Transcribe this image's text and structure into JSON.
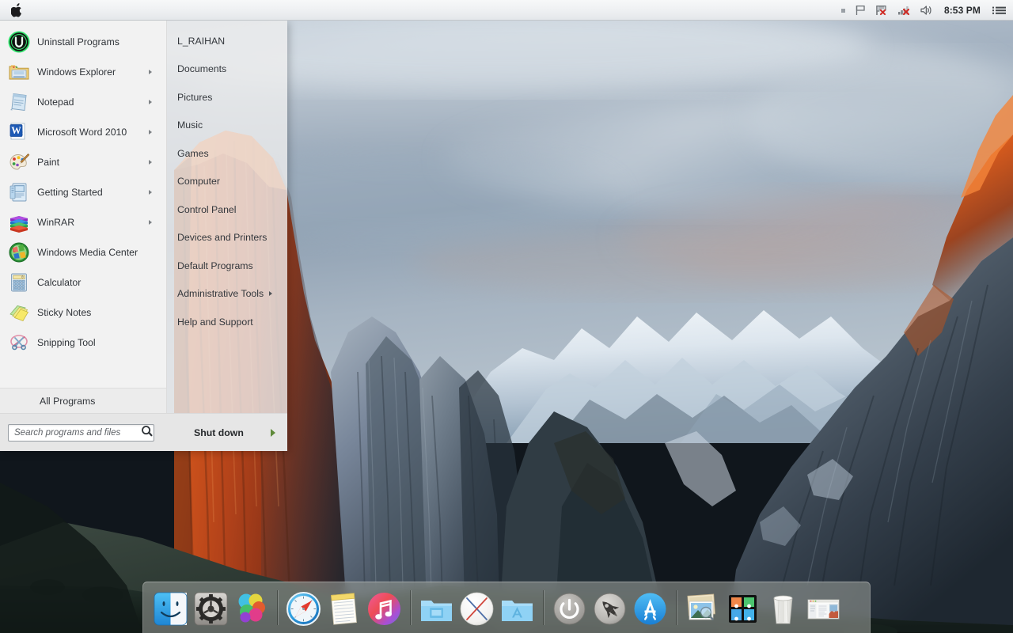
{
  "menubar": {
    "apple_icon": "apple-logo",
    "tray": [
      {
        "name": "dot-indicator",
        "icon": "small-square"
      },
      {
        "name": "flag-icon",
        "icon": "flag"
      },
      {
        "name": "action-center-icon",
        "icon": "flag-with-red-x"
      },
      {
        "name": "network-icon",
        "icon": "network-bars-with-red-x"
      },
      {
        "name": "volume-icon",
        "icon": "speaker"
      }
    ],
    "clock": "8:53 PM",
    "notification_center_icon": "list-menu-icon"
  },
  "startmenu": {
    "programs": [
      {
        "label": "Uninstall Programs",
        "icon": "iobit-uninstaller-icon",
        "has_submenu": false
      },
      {
        "label": "Windows Explorer",
        "icon": "folder-explorer-icon",
        "has_submenu": true
      },
      {
        "label": "Notepad",
        "icon": "notepad-icon",
        "has_submenu": true
      },
      {
        "label": "Microsoft Word 2010",
        "icon": "word-icon",
        "has_submenu": true
      },
      {
        "label": "Paint",
        "icon": "paint-palette-icon",
        "has_submenu": true
      },
      {
        "label": "Getting Started",
        "icon": "getting-started-icon",
        "has_submenu": true
      },
      {
        "label": "WinRAR",
        "icon": "winrar-books-icon",
        "has_submenu": true
      },
      {
        "label": "Windows Media Center",
        "icon": "media-center-icon",
        "has_submenu": false
      },
      {
        "label": "Calculator",
        "icon": "calculator-icon",
        "has_submenu": false
      },
      {
        "label": "Sticky Notes",
        "icon": "sticky-notes-icon",
        "has_submenu": false
      },
      {
        "label": "Snipping Tool",
        "icon": "snipping-scissors-icon",
        "has_submenu": false
      }
    ],
    "all_programs_label": "All Programs",
    "right_links": [
      {
        "label": "L_RAIHAN",
        "has_submenu": false
      },
      {
        "label": "Documents",
        "has_submenu": false
      },
      {
        "label": "Pictures",
        "has_submenu": false
      },
      {
        "label": "Music",
        "has_submenu": false
      },
      {
        "label": "Games",
        "has_submenu": false
      },
      {
        "label": "Computer",
        "has_submenu": false
      },
      {
        "label": "Control Panel",
        "has_submenu": false
      },
      {
        "label": "Devices and Printers",
        "has_submenu": false
      },
      {
        "label": "Default Programs",
        "has_submenu": false
      },
      {
        "label": "Administrative Tools",
        "has_submenu": true
      },
      {
        "label": "Help and Support",
        "has_submenu": false
      }
    ],
    "search": {
      "placeholder": "Search programs and files",
      "value": "",
      "icon": "search-magnifier-icon"
    },
    "shutdown": {
      "label": "Shut down",
      "arrow_icon": "green-right-arrow-icon"
    }
  },
  "dock": {
    "items": [
      {
        "name": "finder",
        "icon": "finder-face-icon"
      },
      {
        "name": "system-preferences",
        "icon": "gear-icon"
      },
      {
        "name": "photos",
        "icon": "color-circles-icon"
      },
      {
        "name": "separator-1",
        "icon": "separator"
      },
      {
        "name": "safari",
        "icon": "compass-icon"
      },
      {
        "name": "notes",
        "icon": "notepad-lined-icon"
      },
      {
        "name": "itunes",
        "icon": "music-note-icon"
      },
      {
        "name": "separator-2",
        "icon": "separator"
      },
      {
        "name": "documents-folder",
        "icon": "blue-folder-icon"
      },
      {
        "name": "os-x-installer",
        "icon": "x-circle-icon"
      },
      {
        "name": "applications-folder",
        "icon": "blue-folder-a-icon"
      },
      {
        "name": "separator-3",
        "icon": "separator"
      },
      {
        "name": "power",
        "icon": "power-button-icon"
      },
      {
        "name": "launchpad",
        "icon": "rocket-icon"
      },
      {
        "name": "app-store",
        "icon": "app-store-icon"
      },
      {
        "name": "separator-4",
        "icon": "separator"
      },
      {
        "name": "preview",
        "icon": "photo-stack-icon"
      },
      {
        "name": "mission-control",
        "icon": "mission-control-icon"
      },
      {
        "name": "trash",
        "icon": "trash-bin-icon"
      },
      {
        "name": "document-preview",
        "icon": "window-thumbnail-icon"
      }
    ]
  },
  "wallpaper": {
    "name": "el-capitan-yosemite-valley"
  },
  "colors": {
    "menubar_bg": "#eef0f2",
    "startmenu_left_bg": "#f2f2f2",
    "startmenu_right_bg": "#eeeeee",
    "startmenu_foot_bg": "#e6e6e6",
    "dock_bg": "#929692",
    "text": "#31353a",
    "shutdown_arrow": "#5f8a3a",
    "rock_orange": "#d4541f",
    "sky_blue": "#b9c6d2"
  }
}
